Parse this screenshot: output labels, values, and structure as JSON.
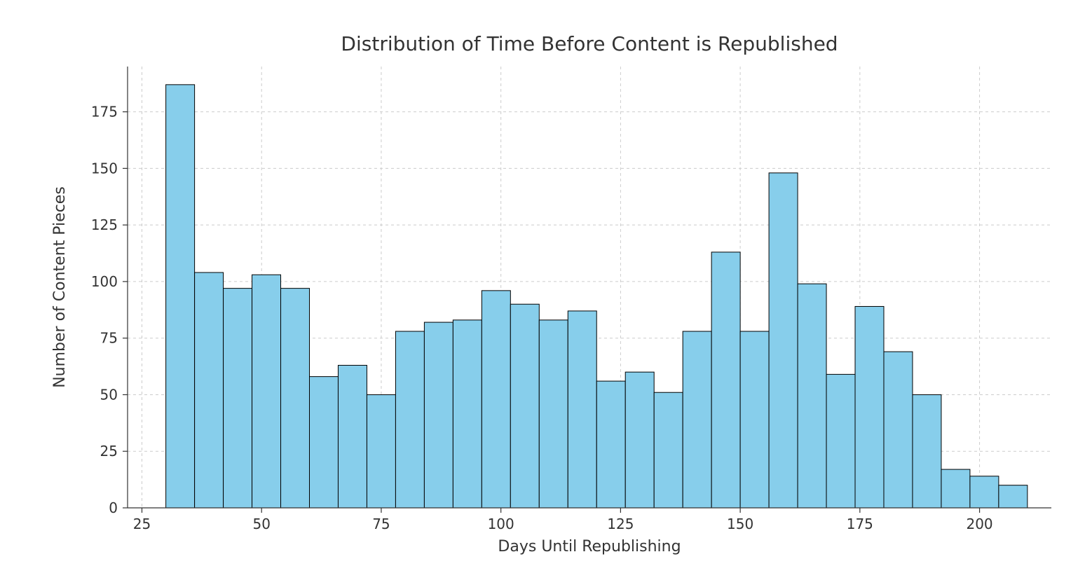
{
  "chart_data": {
    "type": "bar",
    "title": "Distribution of Time Before Content is Republished",
    "xlabel": "Days Until Republishing",
    "ylabel": "Number of Content Pieces",
    "xlim": [
      22,
      215
    ],
    "ylim": [
      0,
      195
    ],
    "x_ticks": [
      25,
      50,
      75,
      100,
      125,
      150,
      175,
      200
    ],
    "y_ticks": [
      0,
      25,
      50,
      75,
      100,
      125,
      150,
      175
    ],
    "bin_width": 6,
    "bin_start": 30,
    "values": [
      187,
      104,
      97,
      103,
      97,
      58,
      63,
      50,
      78,
      82,
      83,
      96,
      90,
      83,
      87,
      56,
      60,
      51,
      78,
      113,
      78,
      148,
      99,
      59,
      89,
      69,
      50,
      17,
      14,
      10
    ],
    "bar_color": "#87ceeb",
    "bar_edge": "#000000"
  }
}
